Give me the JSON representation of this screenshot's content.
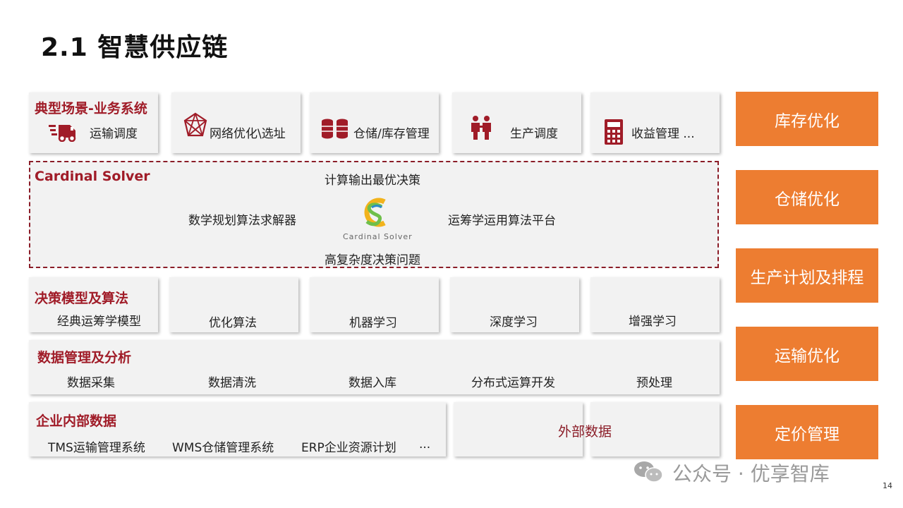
{
  "title": "2.1 智慧供应链",
  "scenarios": {
    "heading": "典型场景-业务系统",
    "items": [
      {
        "label": "运输调度",
        "icon": "truck-icon"
      },
      {
        "label": "网络优化\\选址",
        "icon": "network-icon"
      },
      {
        "label": "仓储/库存管理",
        "icon": "database-icon"
      },
      {
        "label": "生产调度",
        "icon": "workers-icon"
      },
      {
        "label": "收益管理 ...",
        "icon": "calculator-icon"
      }
    ]
  },
  "solver": {
    "heading": "Cardinal Solver",
    "top": "计算输出最优决策",
    "left": "数学规划算法求解器",
    "right": "运筹学运用算法平台",
    "bottom": "高复杂度决策问题",
    "logo_text": "Cardinal Solver"
  },
  "models": {
    "heading": "决策模型及算法",
    "items": [
      "经典运筹学模型",
      "优化算法",
      "机器学习",
      "深度学习",
      "增强学习"
    ]
  },
  "data_mgmt": {
    "heading": "数据管理及分析",
    "items": [
      "数据采集",
      "数据清洗",
      "数据入库",
      "分布式运算开发",
      "预处理"
    ]
  },
  "enterprise": {
    "heading": "企业内部数据",
    "items": [
      "TMS运输管理系统",
      "WMS仓储管理系统",
      "ERP企业资源计划",
      "..."
    ]
  },
  "external": {
    "label": "外部数据"
  },
  "optimizations": [
    "库存优化",
    "仓储优化",
    "生产计划及排程",
    "运输优化",
    "定价管理"
  ],
  "watermark": "公众号 · 优享智库",
  "page_number": "14",
  "colors": {
    "accent": "#ed7d31",
    "heading_red": "#a01c28",
    "panel": "#f2f2f2"
  }
}
